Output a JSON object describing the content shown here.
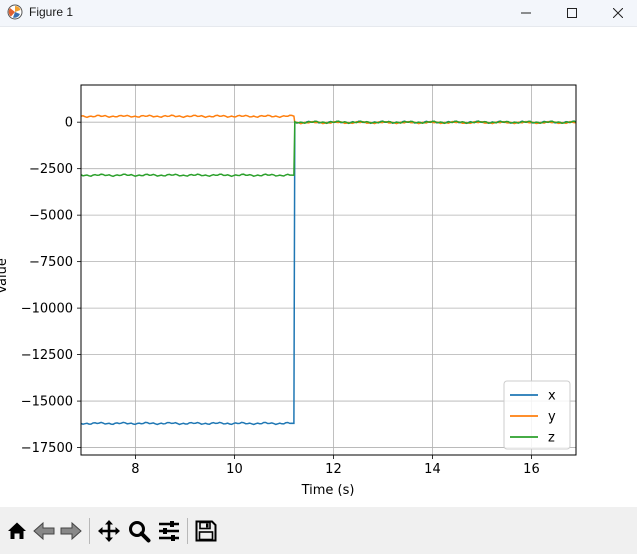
{
  "window": {
    "title": "Figure 1",
    "app_icon": "matplotlib-icon",
    "controls": [
      "minimize-icon",
      "maximize-icon",
      "close-icon"
    ]
  },
  "toolbar": {
    "buttons": [
      "home-icon",
      "back-arrow-icon",
      "forward-arrow-icon",
      "pan-move-icon",
      "zoom-magnifier-icon",
      "configure-subplots-icon",
      "save-floppy-icon"
    ]
  },
  "chart_data": {
    "type": "line",
    "title": "",
    "xlabel": "Time (s)",
    "ylabel": "Value",
    "xlim": [
      6.9,
      16.9
    ],
    "ylim": [
      -17900,
      2000
    ],
    "xticks": [
      8,
      10,
      12,
      14,
      16
    ],
    "yticks": [
      0,
      -2500,
      -5000,
      -7500,
      -10000,
      -12500,
      -15000,
      -17500
    ],
    "grid": true,
    "legend_position": "lower-right",
    "series": [
      {
        "name": "x",
        "color": "#1f77b4",
        "x": [
          6.9,
          11.2,
          11.22,
          16.9
        ],
        "y": [
          -16200,
          -16200,
          0,
          0
        ]
      },
      {
        "name": "y",
        "color": "#ff7f0e",
        "x": [
          6.9,
          11.2,
          11.22,
          16.9
        ],
        "y": [
          320,
          320,
          -20,
          -20
        ]
      },
      {
        "name": "z",
        "color": "#2ca02c",
        "x": [
          6.9,
          11.2,
          11.22,
          16.9
        ],
        "y": [
          -2850,
          -2850,
          0,
          0
        ]
      }
    ]
  }
}
